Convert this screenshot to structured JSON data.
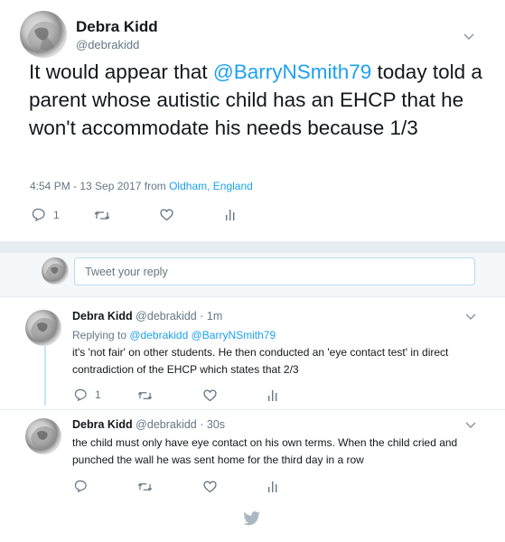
{
  "main_tweet": {
    "name": "Debra Kidd",
    "handle": "@debrakidd",
    "text_prefix": "It would appear that ",
    "mention": "@BarryNSmith79",
    "text_suffix": " today told a parent whose autistic child has an EHCP that he won't accommodate his needs because 1/3",
    "timestamp": "4:54 PM - 13 Sep 2017 from ",
    "location": "Oldham, England",
    "reply_count": "1",
    "retweet_count": "",
    "like_count": ""
  },
  "reply_box": {
    "placeholder": "Tweet your reply"
  },
  "replies": [
    {
      "name": "Debra Kidd",
      "meta": "@debrakidd · 1m",
      "replying_to_label": "Replying to ",
      "replying_to": "@debrakidd @BarryNSmith79",
      "text": "it's 'not fair' on other students. He then conducted an 'eye contact test' in direct contradiction of the EHCP which states that 2/3",
      "reply_count": "1"
    },
    {
      "name": "Debra Kidd",
      "meta": "@debrakidd · 30s",
      "text": "the child must only have eye contact on his own terms. When the child cried and punched the wall he was sent home for the third day in a row",
      "reply_count": ""
    }
  ],
  "icons": {
    "reply": "reply-icon",
    "retweet": "retweet-icon",
    "like": "heart-icon",
    "analytics": "analytics-icon",
    "more": "chevron-down-icon",
    "brand": "twitter-bird-icon"
  },
  "colors": {
    "accent": "#1da1f2",
    "secondary_text": "#657786",
    "separator": "#e6ecf0",
    "thread_line": "#c8e5f9"
  }
}
